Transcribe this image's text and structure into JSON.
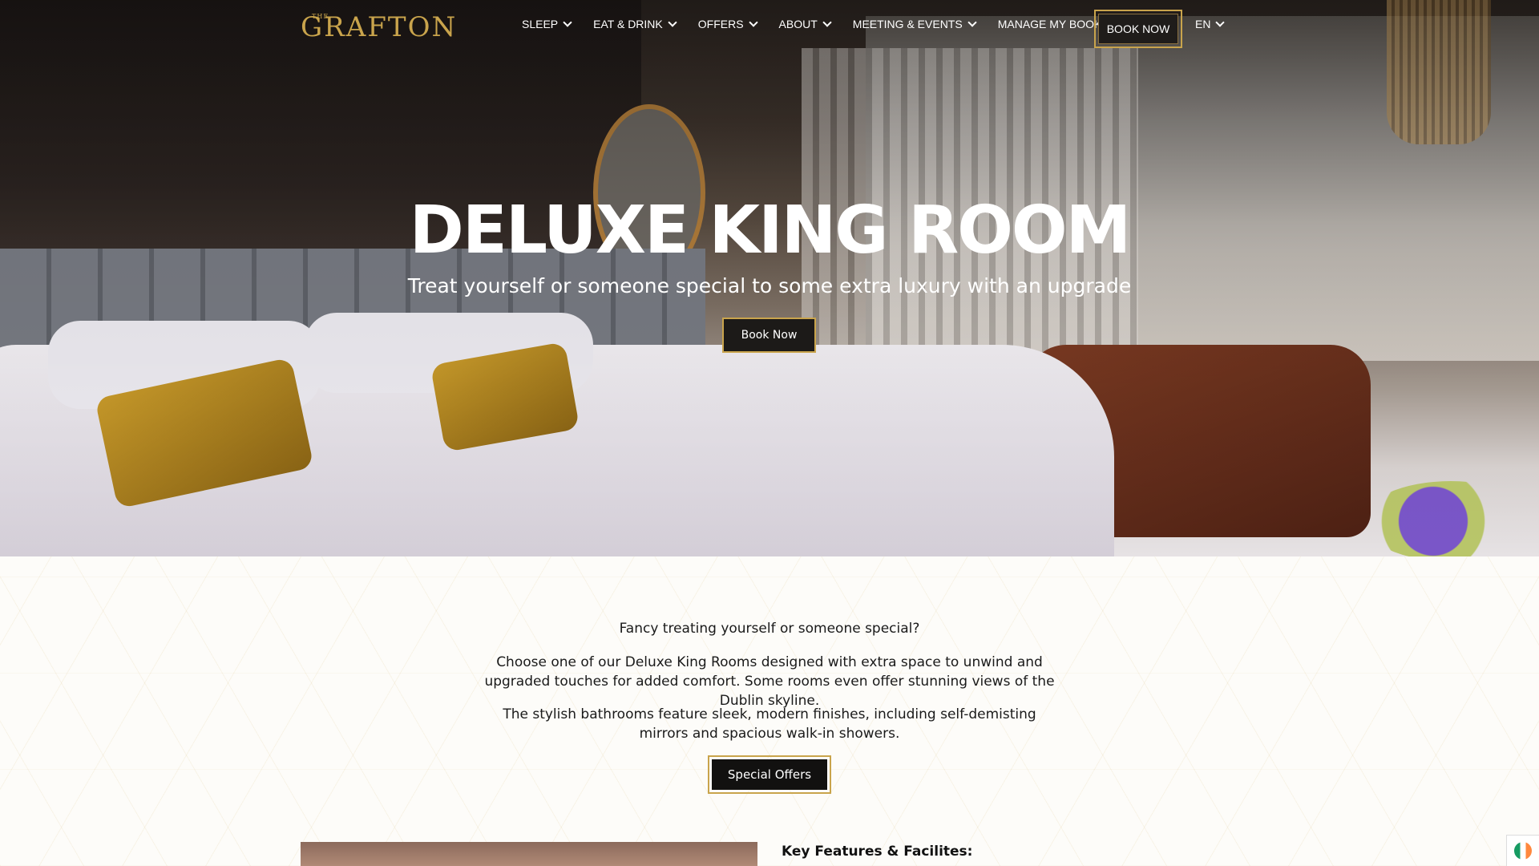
{
  "nav": {
    "logo_small": "THE",
    "logo_name": "GRAFTON",
    "items": [
      {
        "label": "SLEEP",
        "dropdown": true
      },
      {
        "label": "EAT & DRINK",
        "dropdown": true
      },
      {
        "label": "OFFERS",
        "dropdown": true
      },
      {
        "label": "ABOUT",
        "dropdown": true
      },
      {
        "label": "MEETING & EVENTS",
        "dropdown": true
      },
      {
        "label": "MANAGE MY BOOKING",
        "dropdown": false
      }
    ],
    "book_now": "BOOK NOW",
    "language": "EN"
  },
  "hero": {
    "title": "DELUXE KING ROOM",
    "subtitle": "Treat yourself or someone special to some extra luxury with an upgrade",
    "button": "Book Now"
  },
  "content": {
    "intro": "Fancy treating yourself or someone special?",
    "paragraph1": "Choose one of our Deluxe King Rooms designed with extra space to unwind and upgraded touches for added comfort. Some rooms even offer stunning views of the Dublin skyline.",
    "paragraph2": "The stylish bathrooms feature sleek, modern finishes, including self-demisting mirrors and spacious walk-in showers.",
    "offers_button": "Special Offers",
    "features_heading": "Key Features & Facilites:"
  },
  "colors": {
    "accent_gold": "#c9a44c",
    "button_dark": "#1c1a18"
  }
}
